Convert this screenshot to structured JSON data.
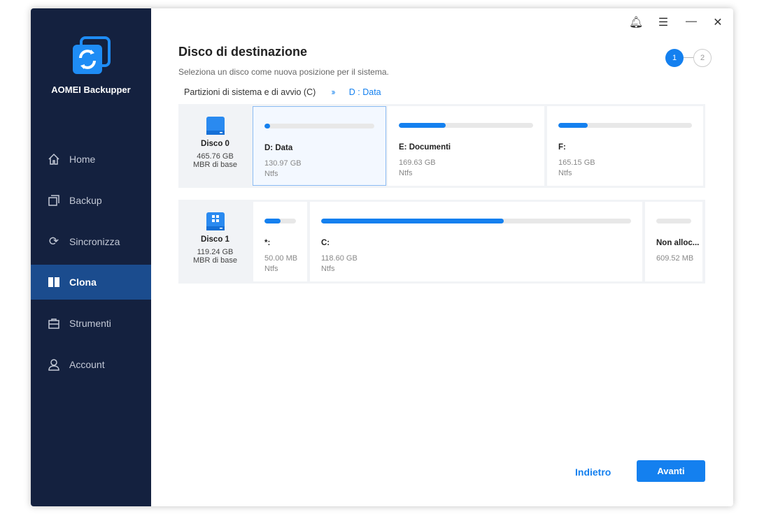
{
  "app": {
    "name": "AOMEI Backupper"
  },
  "sidebar": {
    "items": [
      {
        "label": "Home"
      },
      {
        "label": "Backup"
      },
      {
        "label": "Sincronizza"
      },
      {
        "label": "Clona"
      },
      {
        "label": "Strumenti"
      },
      {
        "label": "Account"
      }
    ],
    "active": "Clona"
  },
  "header": {
    "title": "Disco di destinazione",
    "subtitle": "Seleziona un disco come nuova posizione per il sistema.",
    "steps": [
      "1",
      "2"
    ],
    "current_step": 1
  },
  "breadcrumb": {
    "source": "Partizioni di sistema e di avvio (C)",
    "target": "D : Data"
  },
  "disks": [
    {
      "name": "Disco 0",
      "size": "465.76 GB",
      "type": "MBR di base",
      "partitions": [
        {
          "label": "D: Data",
          "size": "130.97 GB",
          "fs": "Ntfs",
          "used": 0.03,
          "selected": true
        },
        {
          "label": "E: Documenti",
          "size": "169.63 GB",
          "fs": "Ntfs",
          "used": 0.35
        },
        {
          "label": "F:",
          "size": "165.15 GB",
          "fs": "Ntfs",
          "used": 0.22
        }
      ]
    },
    {
      "name": "Disco 1",
      "size": "119.24 GB",
      "type": "MBR di base",
      "partitions": [
        {
          "label": "*:",
          "size": "50.00 MB",
          "fs": "Ntfs",
          "used": 0.5
        },
        {
          "label": "C:",
          "size": "118.60 GB",
          "fs": "Ntfs",
          "used": 0.59
        },
        {
          "label": "Non alloc...",
          "size": "609.52 MB",
          "fs": "",
          "used": 0
        }
      ]
    }
  ],
  "footer": {
    "back": "Indietro",
    "next": "Avanti"
  },
  "colors": {
    "accent": "#1480ef",
    "sidebar": "#14213f",
    "active": "#1b4c8e"
  }
}
